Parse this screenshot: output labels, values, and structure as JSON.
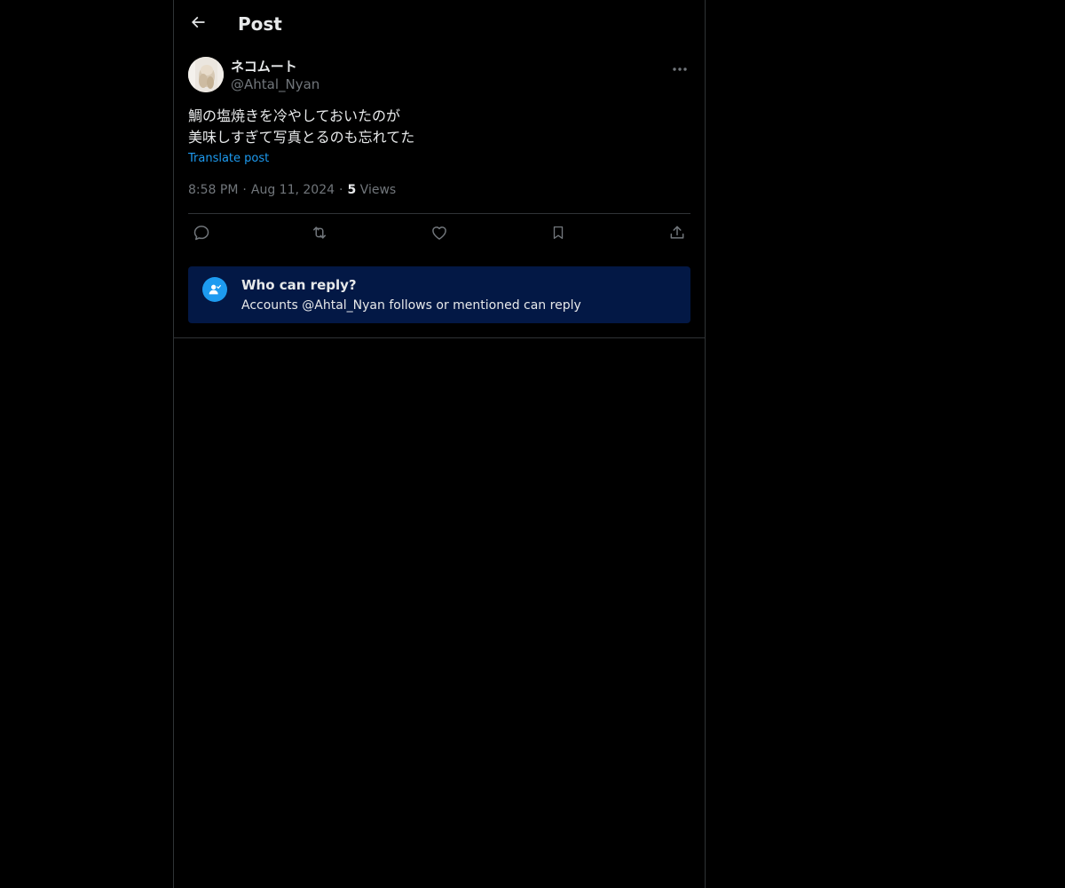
{
  "header": {
    "title": "Post",
    "back_icon": "arrow-left-icon"
  },
  "post": {
    "author": {
      "display_name": "ネコムート",
      "handle": "@Ahtal_Nyan"
    },
    "text_lines": [
      "鯛の塩焼きを冷やしておいたのが",
      "美味しすぎて写真とるのも忘れてた"
    ],
    "translate_label": "Translate post",
    "time": "8:58 PM",
    "separator": "·",
    "date": "Aug 11, 2024",
    "views_count": "5",
    "views_label": "Views",
    "actions": [
      "reply-icon",
      "repost-icon",
      "like-icon",
      "bookmark-icon",
      "share-icon"
    ]
  },
  "reply_restriction": {
    "title": "Who can reply?",
    "description": "Accounts @Ahtal_Nyan follows or mentioned can reply",
    "icon": "person-check-icon"
  },
  "colors": {
    "background": "#000000",
    "text": "#e7e9ea",
    "muted": "#71767b",
    "accent": "#1d9bf0",
    "border": "#2f3336",
    "reply_box_bg": "#031845"
  }
}
